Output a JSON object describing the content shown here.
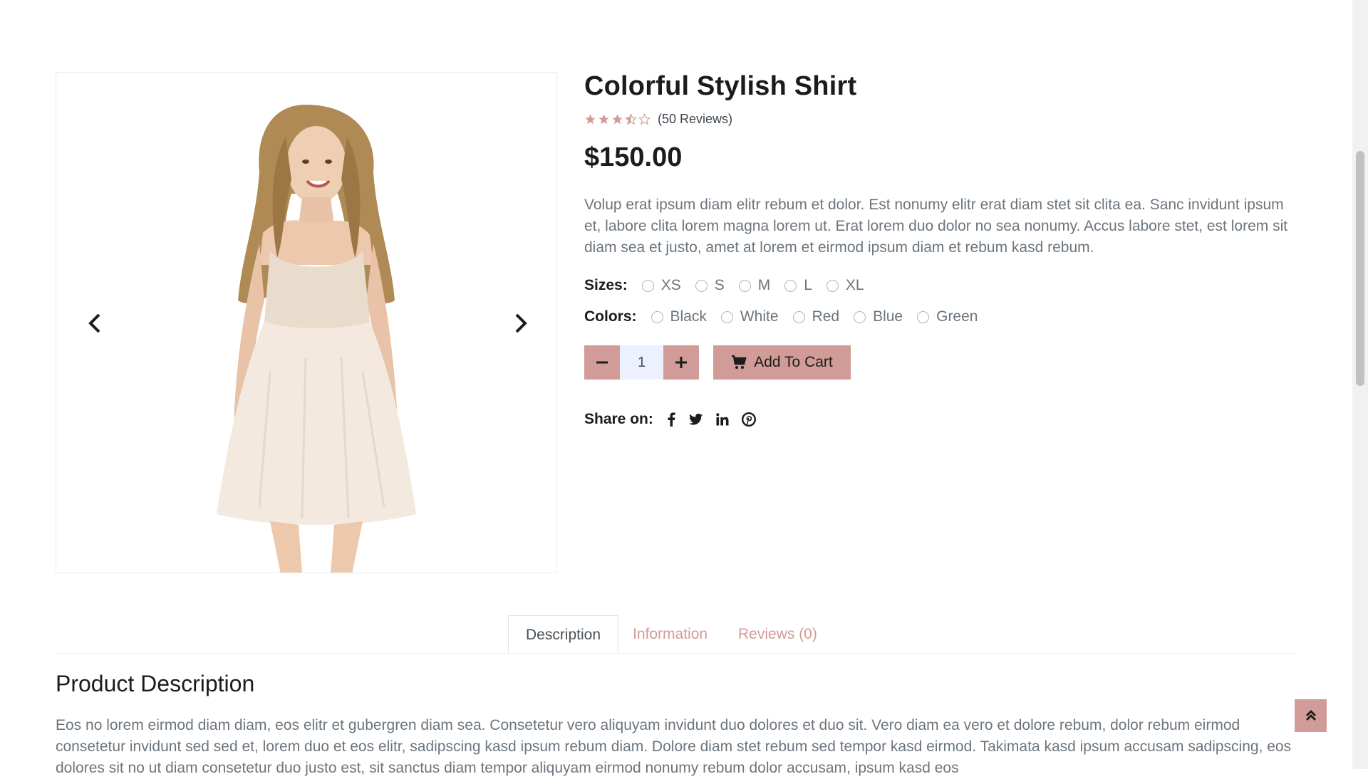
{
  "product": {
    "title": "Colorful Stylish Shirt",
    "rating": 3.5,
    "rating_max": 5,
    "reviews_label": "(50 Reviews)",
    "price": "$150.00",
    "description": "Volup erat ipsum diam elitr rebum et dolor. Est nonumy elitr erat diam stet sit clita ea. Sanc invidunt ipsum et, labore clita lorem magna lorem ut. Erat lorem duo dolor no sea nonumy. Accus labore stet, est lorem sit diam sea et justo, amet at lorem et eirmod ipsum diam et rebum kasd rebum."
  },
  "sizes": {
    "label": "Sizes:",
    "options": [
      "XS",
      "S",
      "M",
      "L",
      "XL"
    ]
  },
  "colors": {
    "label": "Colors:",
    "options": [
      "Black",
      "White",
      "Red",
      "Blue",
      "Green"
    ]
  },
  "cart": {
    "quantity": "1",
    "add_label": "Add To Cart"
  },
  "share": {
    "label": "Share on:",
    "icons": [
      "facebook-icon",
      "twitter-icon",
      "linkedin-icon",
      "pinterest-icon"
    ]
  },
  "tabs": {
    "description": "Description",
    "information": "Information",
    "reviews": "Reviews (0)"
  },
  "description_section": {
    "title": "Product Description",
    "body": "Eos no lorem eirmod diam diam, eos elitr et gubergren diam sea. Consetetur vero aliquyam invidunt duo dolores et duo sit. Vero diam ea vero et dolore rebum, dolor rebum eirmod consetetur invidunt sed sed et, lorem duo et eos elitr, sadipscing kasd ipsum rebum diam. Dolore diam stet rebum sed tempor kasd eirmod. Takimata kasd ipsum accusam sadipscing, eos dolores sit no ut diam consetetur duo justo est, sit sanctus diam tempor aliquyam eirmod nonumy rebum dolor accusam, ipsum kasd eos"
  },
  "colors_theme": {
    "accent": "#d19c97",
    "qty_bg": "#edf1ff",
    "muted_text": "#6c757d"
  }
}
